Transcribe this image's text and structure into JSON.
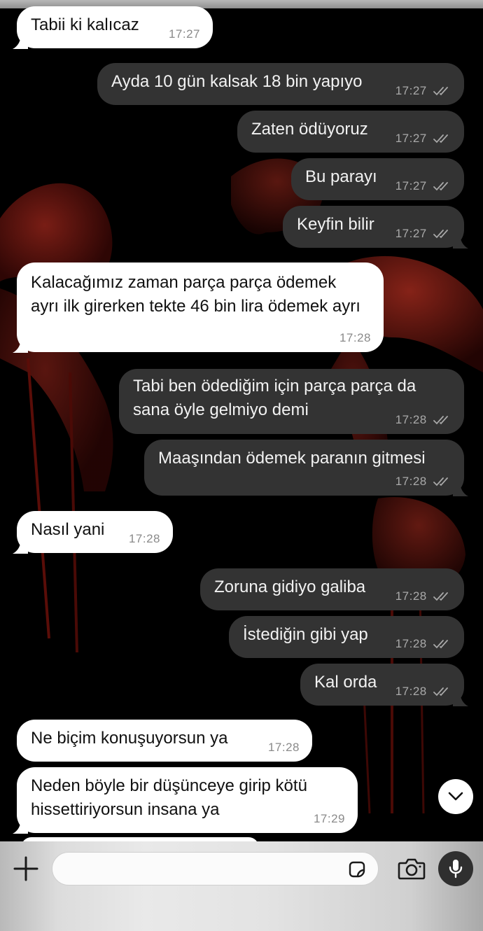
{
  "messages": [
    {
      "dir": "in",
      "text": "Tabii ki kalıcaz",
      "time": "17:27"
    },
    {
      "dir": "out",
      "text": "Ayda 10 gün kalsak 18 bin yapıyo",
      "time": "17:27"
    },
    {
      "dir": "out",
      "text": "Zaten ödüyoruz",
      "time": "17:27"
    },
    {
      "dir": "out",
      "text": "Bu parayı",
      "time": "17:27"
    },
    {
      "dir": "out",
      "text": "Keyfin bilir",
      "time": "17:27"
    },
    {
      "dir": "in",
      "text": "Kalacağımız zaman parça parça ödemek ayrı ilk girerken tekte 46 bin lira ödemek ayrı",
      "time": "17:28"
    },
    {
      "dir": "out",
      "text": "Tabi ben ödediğim için parça parça da sana öyle gelmiyo demi",
      "time": "17:28"
    },
    {
      "dir": "out",
      "text": "Maaşından ödemek paranın gitmesi",
      "time": "17:28"
    },
    {
      "dir": "in",
      "text": "Nasıl yani",
      "time": "17:28"
    },
    {
      "dir": "out",
      "text": "Zoruna gidiyo galiba",
      "time": "17:28"
    },
    {
      "dir": "out",
      "text": "İstediğin gibi yap",
      "time": "17:28"
    },
    {
      "dir": "out",
      "text": "Kal orda",
      "time": "17:28"
    },
    {
      "dir": "in",
      "text": "Ne biçim konuşuyorsun ya",
      "time": "17:28"
    },
    {
      "dir": "in",
      "text": "Neden böyle bir düşünceye girip kötü hissettiriyorsun insana ya",
      "time": "17:29"
    }
  ],
  "composer": {
    "placeholder": "",
    "icons": [
      "plus-icon",
      "sticker-icon",
      "camera-icon",
      "microphone-icon"
    ]
  },
  "scroll_button_icon": "chevron-down-icon",
  "colors": {
    "incoming_bubble": "#ffffff",
    "outgoing_bubble": "#333333",
    "wallpaper_accent": "#8a1f16"
  }
}
